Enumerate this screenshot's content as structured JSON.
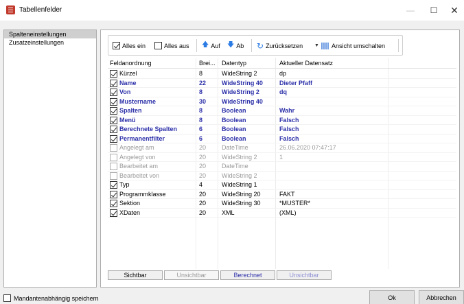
{
  "window": {
    "title": "Tabellenfelder",
    "icon": "table-app-icon",
    "controls": [
      "minimize-icon",
      "maximize-icon",
      "close-icon"
    ]
  },
  "sidebar": {
    "items": [
      {
        "label": "Spalteneinstellungen",
        "selected": true
      },
      {
        "label": "Zusatzeinstellungen",
        "selected": false
      }
    ]
  },
  "toolbar": {
    "all_on": "Alles ein",
    "all_off": "Alles aus",
    "up": "Auf",
    "down": "Ab",
    "reset": "Zurücksetzen",
    "toggle_view": "Ansicht umschalten"
  },
  "columns": [
    "Feldanordnung",
    "Brei...",
    "Datentyp",
    "Aktueller Datensatz"
  ],
  "rows": [
    {
      "name": "Kürzel",
      "width": "8",
      "type": "WideString  2",
      "value": "dp",
      "checked": true,
      "style": "black"
    },
    {
      "name": "Name",
      "width": "22",
      "type": "WideString 40",
      "value": "Dieter Pfaff",
      "checked": true,
      "style": "blue"
    },
    {
      "name": "Von",
      "width": "8",
      "type": "WideString  2",
      "value": "dq",
      "checked": true,
      "style": "blue"
    },
    {
      "name": "Mustername",
      "width": "30",
      "type": "WideString 40",
      "value": "",
      "checked": true,
      "style": "blue"
    },
    {
      "name": "Spalten",
      "width": "8",
      "type": "Boolean",
      "value": "Wahr",
      "checked": true,
      "style": "blue"
    },
    {
      "name": "Menü",
      "width": "8",
      "type": "Boolean",
      "value": "Falsch",
      "checked": true,
      "style": "blue"
    },
    {
      "name": "Berechnete Spalten",
      "width": "6",
      "type": "Boolean",
      "value": "Falsch",
      "checked": true,
      "style": "blue"
    },
    {
      "name": "Permanentfilter",
      "width": "6",
      "type": "Boolean",
      "value": "Falsch",
      "checked": true,
      "style": "blue"
    },
    {
      "name": "Angelegt am",
      "width": "20",
      "type": "DateTime",
      "value": "26.06.2020 07:47:17",
      "checked": false,
      "style": "gray"
    },
    {
      "name": "Angelegt von",
      "width": "20",
      "type": "WideString  2",
      "value": "1",
      "checked": false,
      "style": "gray"
    },
    {
      "name": "Bearbeitet am",
      "width": "20",
      "type": "DateTime",
      "value": "",
      "checked": false,
      "style": "gray"
    },
    {
      "name": "Bearbeitet von",
      "width": "20",
      "type": "WideString  2",
      "value": "",
      "checked": false,
      "style": "gray"
    },
    {
      "name": "Typ",
      "width": "4",
      "type": "WideString  1",
      "value": "",
      "checked": true,
      "style": "black"
    },
    {
      "name": "Programmklasse",
      "width": "20",
      "type": "WideString 20",
      "value": "FAKT",
      "checked": true,
      "style": "black"
    },
    {
      "name": "Sektion",
      "width": "20",
      "type": "WideString 30",
      "value": "*MUSTER*",
      "checked": true,
      "style": "black"
    },
    {
      "name": "XDaten",
      "width": "20",
      "type": "XML",
      "value": "(XML)",
      "checked": true,
      "style": "black"
    }
  ],
  "legend_tabs": [
    "Sichtbar",
    "Unsichtbar",
    "Berechnet",
    "Unsichtbar"
  ],
  "footer": {
    "tenant_save": "Mandantenabhängig speichern",
    "ok": "Ok",
    "cancel": "Abbrechen"
  }
}
